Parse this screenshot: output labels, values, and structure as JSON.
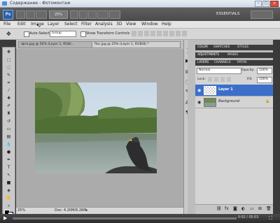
{
  "window": {
    "title": "Содержание - Фотомонтаж"
  },
  "appbar": {
    "zoom": "25%",
    "workspace": "ESSENTIALS"
  },
  "menu": [
    "File",
    "Edit",
    "Image",
    "Layer",
    "Select",
    "Filter",
    "Analysis",
    "3D",
    "View",
    "Window",
    "Help"
  ],
  "options": {
    "auto_select_label": "Auto-Select:",
    "auto_select_value": "Group",
    "show_transform_label": "Show Transform Controls"
  },
  "doc_tabs": [
    "dpra.jpg @ 50% (Layer 1, RGB/...",
    "flac.jpg @ 25% (Layer 1, RGB/8) *"
  ],
  "status": {
    "zoom": "25%",
    "doc": "Doc: 4.20M/6.26M"
  },
  "panel_tabs_1": [
    "COLOR",
    "SWATCHES",
    "STYLES"
  ],
  "panel_tabs_2": [
    "ADJUSTMENTS",
    "MASKS"
  ],
  "panel_tabs_3": [
    "LAYERS",
    "CHANNELS",
    "PATHS"
  ],
  "layers": {
    "blend_mode": "Normal",
    "opacity_label": "Opacity:",
    "opacity": "100%",
    "lock_label": "Lock:",
    "fill_label": "Fill:",
    "fill": "100%",
    "items": [
      {
        "name": "Layer 1",
        "selected": true
      },
      {
        "name": "Background",
        "selected": false
      }
    ]
  },
  "player": {
    "time": "0:02 / 05:03"
  },
  "colors": {
    "accent": "#3b78d8",
    "selected_layer": "#3b6fc9"
  }
}
